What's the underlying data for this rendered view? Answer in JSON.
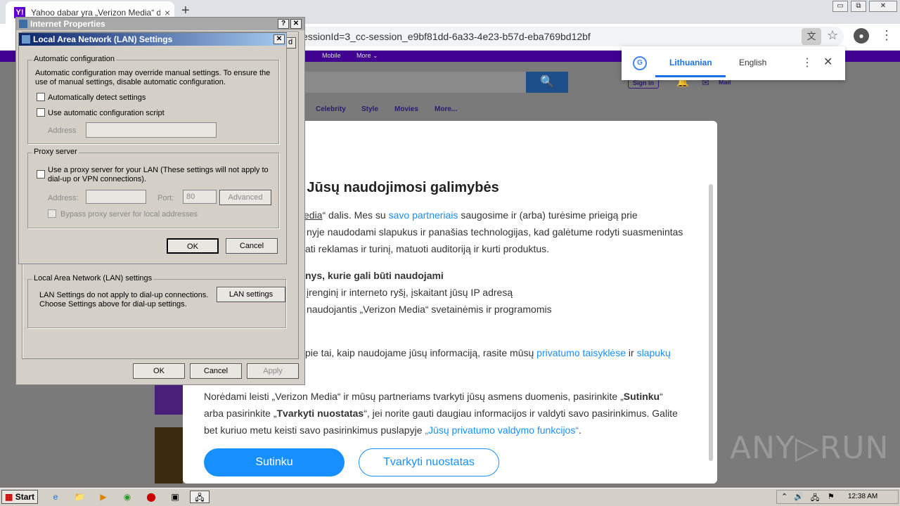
{
  "browser": {
    "tab_title": "Yahoo dabar yra „Verizon Media“ dal",
    "tab_close": "×",
    "new_tab": "+",
    "favicon": "Y!",
    "url": "essionId=3_cc-session_e9bf81dd-6a33-4e23-b57d-eba769bd12bf",
    "win_min": "▭",
    "win_restore": "⧉",
    "win_close": "✕",
    "translate_glyph": "文",
    "star_glyph": "☆",
    "profile_glyph": "●",
    "menu_glyph": "⋮"
  },
  "translate_popup": {
    "icon": "G",
    "lang_active": "Lithuanian",
    "lang_other": "English",
    "more": "⋮",
    "close": "✕"
  },
  "yahoo": {
    "bar_items": [
      "Mobile",
      "More ⌄"
    ],
    "search_icon": "🔍",
    "signin": "Sign in",
    "bell": "🔔",
    "mail_icon": "✉",
    "mail": "Mail",
    "nav": [
      "Celebrity",
      "Style",
      "Movies",
      "More..."
    ]
  },
  "consent": {
    "title": "ys. Jūsų naudojimosi galimybės",
    "p1_l1_a": "edia",
    "p1_l1_b": "“ dalis. Mes su ",
    "p1_l1_link": "savo partneriais",
    "p1_l1_c": " saugosime ir (arba) turėsime prieigą prie",
    "p1_l2": "nyje naudodami slapukus ir panašias technologijas, kad galėtume rodyti suasmenintas",
    "p1_l3": "ati reklamas ir turinį, matuoti auditoriją ir kurti produktus.",
    "h2": "nys, kurie gali būti naudojami",
    "li1": "įrenginį ir interneto ryšį, įskaitant jūsų IP adresą",
    "li2": "naudojantis „Verizon Media“ svetainėmis ir programomis",
    "p2_a": "pie tai, kaip naudojame jūsų informaciją, rasite mūsų ",
    "p2_link1": "privatumo taisyklėse",
    "p2_b": " ir ",
    "p2_link2": "slapukų",
    "p3_l1_a": "Norėdami leisti „Verizon Media“ ir mūsų partneriams tvarkyti jūsų asmens duomenis, pasirinkite „",
    "p3_l1_b": "Sutinku",
    "p3_l1_c": "“",
    "p3_l2_a": "arba pasirinkite „",
    "p3_l2_b": "Tvarkyti nuostatas",
    "p3_l2_c": "“, jei norite gauti daugiau informacijos ir valdyti savo pasirinkimus. Galite",
    "p3_l3_a": "bet kuriuo metu keisti savo pasirinkimus puslapyje ",
    "p3_l3_link": "„Jūsų privatumo valdymo funkcijos“",
    "p3_l3_b": ".",
    "btn_accept": "Sutinku",
    "btn_manage": "Tvarkyti nuostatas"
  },
  "internet_props": {
    "title": "Internet Properties",
    "help": "?",
    "close": "✕",
    "lan_group": "Local Area Network (LAN) settings",
    "lan_text1": "LAN Settings do not apply to dial-up connections.",
    "lan_text2": "Choose Settings above for dial-up settings.",
    "lan_btn": "LAN settings",
    "ok": "OK",
    "cancel": "Cancel",
    "apply": "Apply",
    "behind_btn": "d"
  },
  "lan_dialog": {
    "title": "Local Area Network (LAN) Settings",
    "close": "✕",
    "auto_group": "Automatic configuration",
    "auto_desc1": "Automatic configuration may override manual settings.  To ensure the",
    "auto_desc2": "use of manual settings, disable automatic configuration.",
    "auto_detect": "Automatically detect settings",
    "auto_script": "Use automatic configuration script",
    "address": "Address",
    "proxy_group": "Proxy server",
    "proxy_use1": "Use a proxy server for your LAN (These settings will not apply to",
    "proxy_use2": "dial-up or VPN connections).",
    "proxy_address": "Address:",
    "proxy_port": "Port:",
    "port_value": "80",
    "advanced": "Advanced",
    "bypass": "Bypass proxy server for local addresses",
    "ok": "OK",
    "cancel": "Cancel"
  },
  "taskbar": {
    "start": "Start",
    "clock": "12:38 AM",
    "icons": [
      "e",
      "📁",
      "▶",
      "◉",
      "⬤",
      "▣",
      "🖧"
    ],
    "tray": [
      "⌃",
      "🔊",
      "🖧",
      "⚑"
    ]
  },
  "watermark": "ANY▷RUN"
}
